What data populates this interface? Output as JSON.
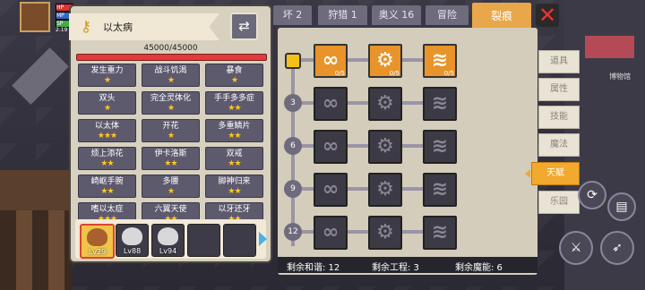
{
  "hud": {
    "hp": "HP",
    "mp": "MP",
    "sp": "SP",
    "lv_text": "2.19"
  },
  "left_panel": {
    "title": "以太病",
    "hp_text": "45000/45000",
    "talents": [
      {
        "name": "发生重力",
        "stars": "★"
      },
      {
        "name": "战斗饥渴",
        "stars": "★"
      },
      {
        "name": "暴食",
        "stars": "★"
      },
      {
        "name": "双头",
        "stars": "★"
      },
      {
        "name": "完全灵体化",
        "stars": "★"
      },
      {
        "name": "手手多多症",
        "stars": "★★"
      },
      {
        "name": "以太体",
        "stars": "★★★"
      },
      {
        "name": "开花",
        "stars": "★"
      },
      {
        "name": "多重鳞片",
        "stars": "★★"
      },
      {
        "name": "烦上添花",
        "stars": "★★"
      },
      {
        "name": "伊卡洛斯",
        "stars": "★★"
      },
      {
        "name": "双戒",
        "stars": "★★"
      },
      {
        "name": "崎岖手腕",
        "stars": "★★"
      },
      {
        "name": "多腰",
        "stars": "★"
      },
      {
        "name": "脚神归来",
        "stars": "★★"
      },
      {
        "name": "嗜以太症",
        "stars": "★★★"
      },
      {
        "name": "六翼天使",
        "stars": "★★"
      },
      {
        "name": "以牙还牙",
        "stars": "★★"
      }
    ],
    "slots": [
      {
        "level": "Lv29"
      },
      {
        "level": "Lv88"
      },
      {
        "level": "Lv94"
      },
      {
        "level": ""
      },
      {
        "level": ""
      }
    ]
  },
  "tabs": [
    {
      "label": "坏 2"
    },
    {
      "label": "狩猎 1"
    },
    {
      "label": "奥义 16"
    },
    {
      "label": "冒险"
    },
    {
      "label": "裂痕"
    }
  ],
  "tree": {
    "row_labels": [
      "3",
      "6",
      "9",
      "12"
    ],
    "counts": [
      "0/5",
      "0/5",
      "0/5"
    ],
    "icons": {
      "link": "∞",
      "gear": "⚙",
      "claw": "≋"
    }
  },
  "footer": {
    "harmony": "剩余和谐: 12",
    "engineering": "剩余工程: 3",
    "magic": "剩余魔能: 6"
  },
  "side_tabs": [
    "道具",
    "属性",
    "技能",
    "魔法",
    "天赋",
    "乐园"
  ],
  "right_hud": {
    "museum": "博物馆"
  },
  "colors": {
    "accent": "#e8942a",
    "active_tab": "#e8a74a",
    "star": "#ffc81e",
    "hp": "#e23b3b"
  }
}
